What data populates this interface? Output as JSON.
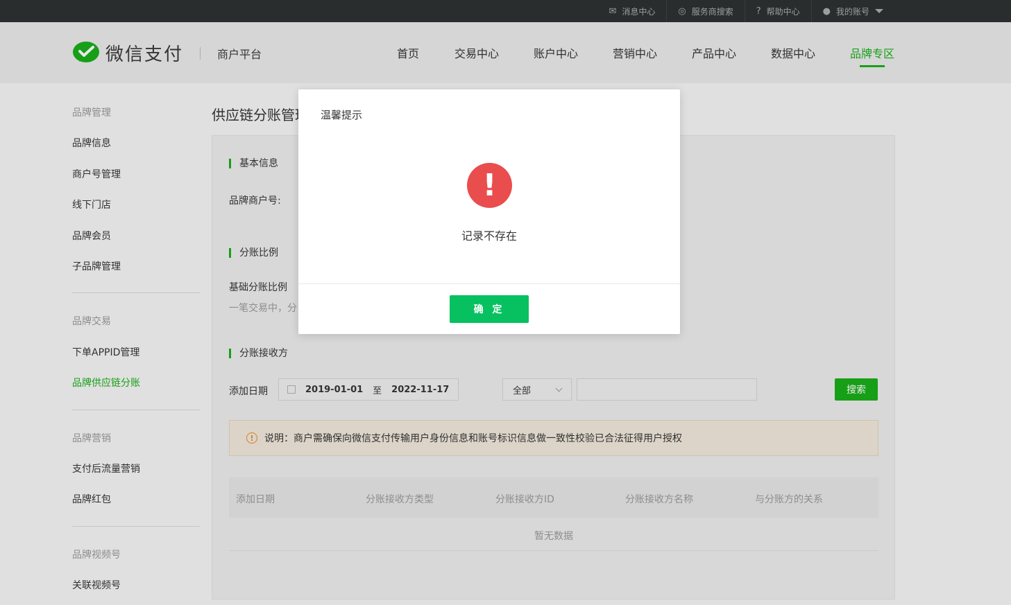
{
  "topbar": {
    "links": [
      {
        "label": "消息中心",
        "icon": "mail-icon"
      },
      {
        "label": "服务商搜索",
        "icon": "search-icon"
      },
      {
        "label": "帮助中心",
        "icon": "help-icon"
      },
      {
        "label": "我的账号",
        "icon": "user-icon"
      }
    ]
  },
  "header": {
    "brand": "微信支付",
    "platform": "商户平台",
    "nav": [
      "首页",
      "交易中心",
      "账户中心",
      "营销中心",
      "产品中心",
      "数据中心",
      "品牌专区"
    ],
    "active_nav": "品牌专区"
  },
  "sidebar": {
    "groups": [
      {
        "title": "品牌管理",
        "items": [
          "品牌信息",
          "商户号管理",
          "线下门店",
          "品牌会员",
          "子品牌管理"
        ]
      },
      {
        "title": "品牌交易",
        "items": [
          "下单APPID管理",
          "品牌供应链分账"
        ]
      },
      {
        "title": "品牌营销",
        "items": [
          "支付后流量营销",
          "品牌红包"
        ]
      },
      {
        "title": "品牌视频号",
        "items": [
          "关联视频号"
        ]
      }
    ],
    "active_item": "品牌供应链分账"
  },
  "main": {
    "title": "供应链分账管理",
    "sections": {
      "basic": "基本信息",
      "ratio": "分账比例",
      "receivers": "分账接收方"
    },
    "brand_merchant_label": "品牌商户号:",
    "base_ratio_label": "基础分账比例",
    "ratio_desc": "一笔交易中，分",
    "filter": {
      "date_label": "添加日期",
      "date_from": "2019-01-01",
      "date_to_sep": "至",
      "date_to": "2022-11-17",
      "type_select": "全部",
      "search_button": "搜索"
    },
    "notice": "说明：商户需确保向微信支付传输用户身份信息和账号标识信息做一致性校验已合法征得用户授权",
    "table": {
      "columns": [
        "添加日期",
        "分账接收方类型",
        "分账接收方ID",
        "分账接收方名称",
        "与分账方的关系"
      ],
      "empty_text": "暂无数据"
    }
  },
  "modal": {
    "title": "温馨提示",
    "message": "记录不存在",
    "ok_label": "确 定",
    "icon_glyph": "!"
  },
  "colors": {
    "brand_green": "#1aad19",
    "button_green": "#07c160",
    "error_red": "#ea4d4d",
    "topbar_bg": "#2e3132"
  }
}
